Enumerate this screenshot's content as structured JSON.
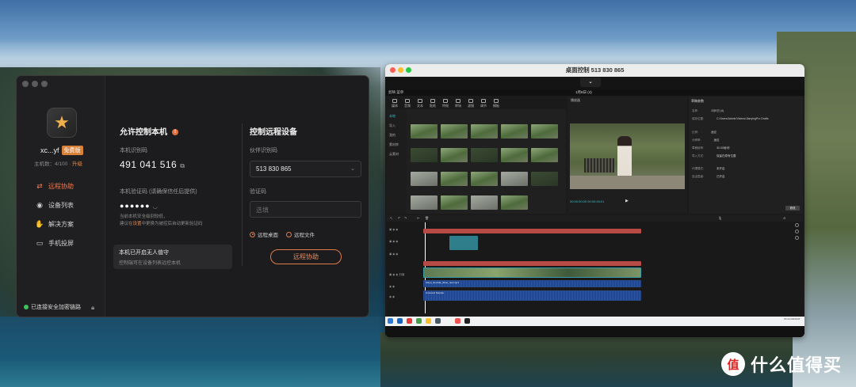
{
  "left_app": {
    "username": "xc...yf",
    "member_badge": "免费版",
    "device_count": "主机数：4/100 · ",
    "upgrade": "升级",
    "nav": [
      {
        "label": "远程协助",
        "icon": "remote-assist-icon"
      },
      {
        "label": "设备列表",
        "icon": "device-list-icon"
      },
      {
        "label": "解决方案",
        "icon": "solutions-icon"
      },
      {
        "label": "手机投屏",
        "icon": "phone-cast-icon"
      }
    ],
    "status": "已连接安全加密链路",
    "allow_control": {
      "title": "允许控制本机",
      "id_label": "本机识别码",
      "id_value": "491 041 516",
      "code_label": "本机验证码 (请确保信任后提供)",
      "code_value": "●●●●●●",
      "note_line1": "当前本机安全级别较低，",
      "note_line2_a": "建议在",
      "note_line2_link": "设置",
      "note_line2_b": "中更换为被控后自动更新验证码",
      "unattended_title": "本机已开启无人值守",
      "unattended_sub": "控制端可在设备列表远控本机"
    },
    "control_remote": {
      "title": "控制远程设备",
      "partner_label": "伙伴识别码",
      "partner_value": "513 830 865",
      "code_label": "验证码",
      "code_placeholder": "选填",
      "radio_desktop": "远程桌面",
      "radio_file": "远程文件",
      "button": "远程协助"
    }
  },
  "remote_window": {
    "title": "桌面控制 513 830 865",
    "toolbar_toggle": "⌄",
    "editor": {
      "menu": "剪映   菜单",
      "project": "1月8日 (4)",
      "tools": [
        "媒体",
        "音频",
        "文本",
        "贴纸",
        "特效",
        "转场",
        "滤镜",
        "调节",
        "模板"
      ],
      "side_items": [
        "本地",
        "导入",
        "我的",
        "素材库",
        "云素材"
      ],
      "player_title": "播放器",
      "timecode": "00:00:00:00  00:00:45:21",
      "props_tabs": "草稿参数",
      "props": [
        {
          "k": "名称:",
          "v": "1月8日 (4)"
        },
        {
          "k": "保存位置:",
          "v": "C:/Users/Admin/Videos/JianyingPro Drafts"
        },
        {
          "k": "比例:",
          "v": "适应"
        },
        {
          "k": "分辨率:",
          "v": "适应"
        },
        {
          "k": "草稿帧率:",
          "v": "30.00帧/秒"
        },
        {
          "k": "导入方式:",
          "v": "保留在原有位置"
        },
        {
          "k": "代理模式:",
          "v": "未开启"
        },
        {
          "k": "自由层级:",
          "v": "已开启"
        }
      ],
      "modify_button": "修改",
      "track_audio_label": "Ukiyo_Sumida_Jibun_new.mp4",
      "track_audio2_label": "Unsound Sample"
    },
    "taskbar_clock": "15:10\n2023/1/8"
  },
  "watermark": {
    "logo": "值",
    "text": "什么值得买"
  },
  "colors": {
    "accent": "#e07a4a",
    "status_green": "#3ec15a",
    "teal": "#36c0c9"
  }
}
